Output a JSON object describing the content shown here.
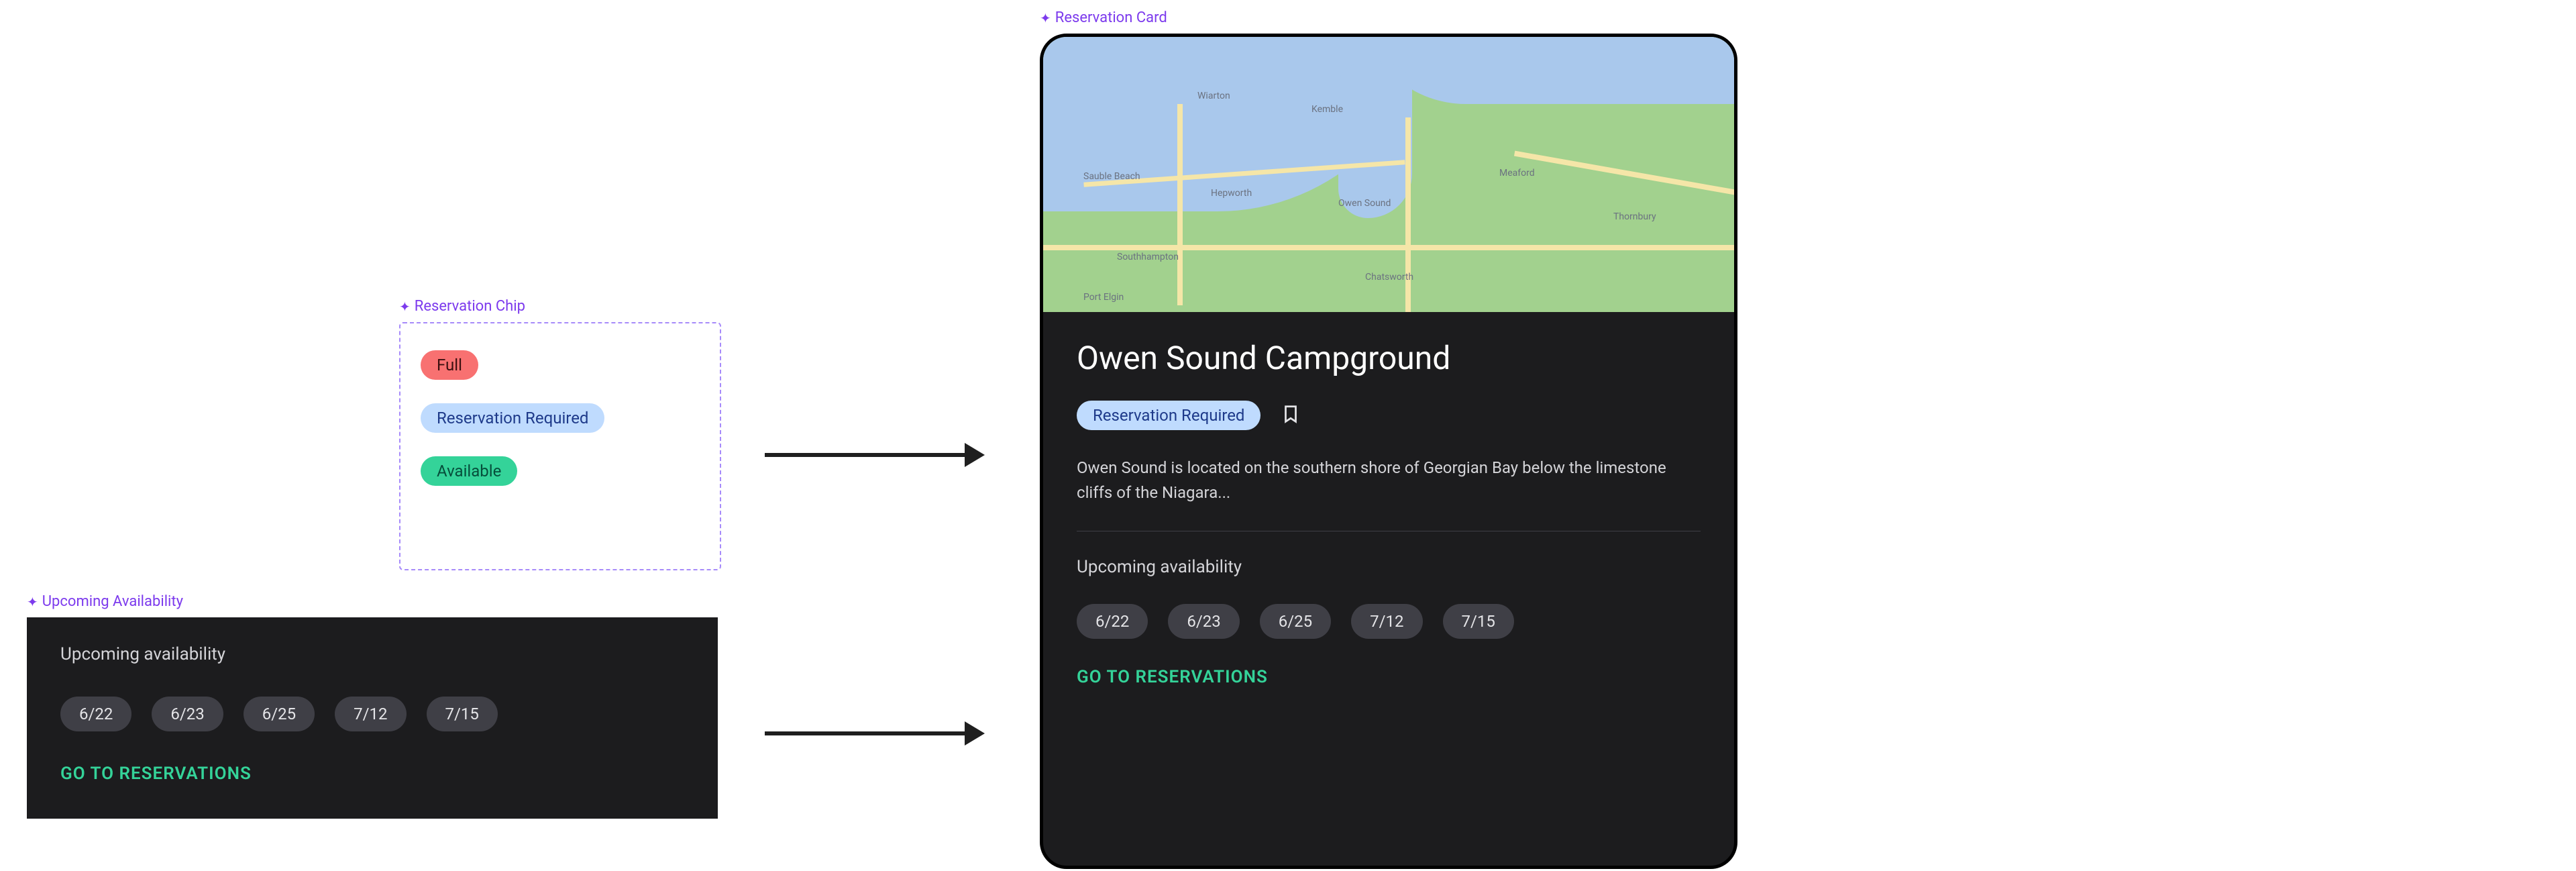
{
  "annotations": {
    "chip_group": "Reservation Chip",
    "upcoming": "Upcoming Availability",
    "card": "Reservation Card"
  },
  "chips": {
    "full": "Full",
    "reservation_required": "Reservation Required",
    "available": "Available"
  },
  "upcoming": {
    "title": "Upcoming availability",
    "dates": [
      "6/22",
      "6/23",
      "6/25",
      "7/12",
      "7/15"
    ],
    "cta": "GO TO RESERVATIONS"
  },
  "card": {
    "title": "Owen Sound Campground",
    "status_chip": "Reservation Required",
    "description": "Owen Sound is located on the southern shore of Georgian Bay below the limestone cliffs of the Niagara...",
    "upcoming_title": "Upcoming availability",
    "dates": [
      "6/22",
      "6/23",
      "6/25",
      "7/12",
      "7/15"
    ],
    "cta": "GO TO RESERVATIONS",
    "map_labels": [
      "Wiarton",
      "Kemble",
      "Sauble Beach",
      "Hepworth",
      "Owen Sound",
      "Meaford",
      "Thornbury",
      "Southhampton",
      "Chatsworth",
      "Port Elgin"
    ]
  },
  "colors": {
    "accent_purple": "#7c3aed",
    "chip_full": "#f87171",
    "chip_res": "#bfdbfe",
    "chip_avail": "#34d399",
    "cta_green": "#34d399",
    "card_bg": "#1c1c1e"
  }
}
